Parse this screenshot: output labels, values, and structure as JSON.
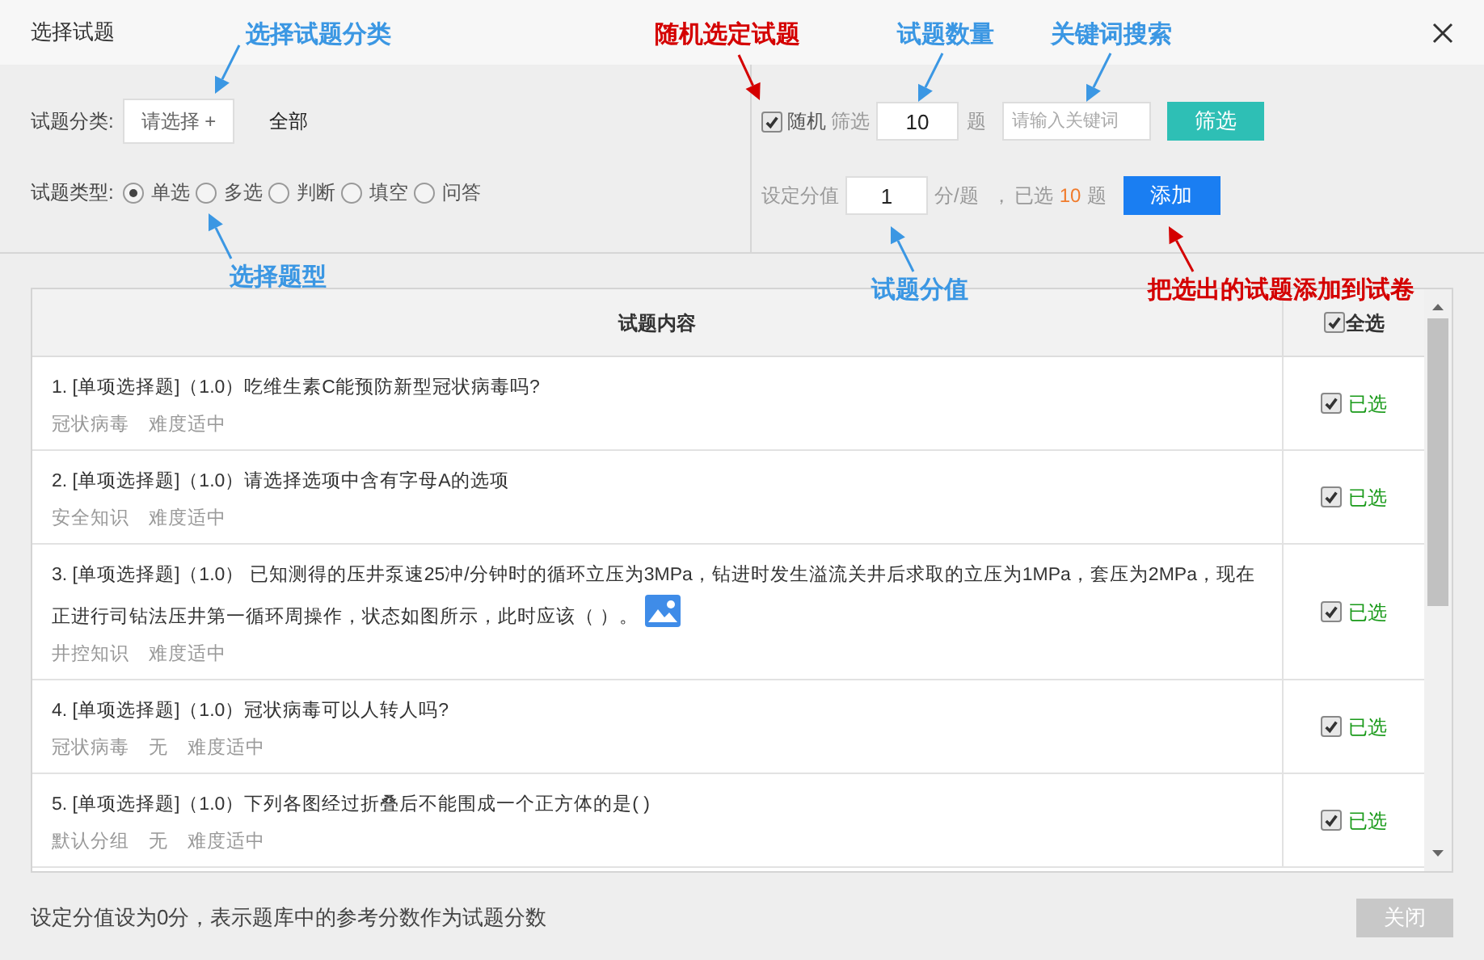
{
  "window": {
    "title": "选择试题"
  },
  "category": {
    "label": "试题分类:",
    "button": "请选择 +",
    "value": "全部"
  },
  "type_filter": {
    "label": "试题类型:",
    "options": [
      {
        "label": "单选",
        "selected": true
      },
      {
        "label": "多选",
        "selected": false
      },
      {
        "label": "判断",
        "selected": false
      },
      {
        "label": "填空",
        "selected": false
      },
      {
        "label": "问答",
        "selected": false
      }
    ]
  },
  "random": {
    "label": "随机",
    "checked": true,
    "prefix": "筛选",
    "count": "10",
    "unit": "题"
  },
  "keyword": {
    "placeholder": "请输入关键词"
  },
  "filter_button": "筛选",
  "score": {
    "label": "设定分值",
    "value": "1",
    "unit": "分/题",
    "separator": "，",
    "selected_prefix": "已选",
    "selected_count": "10",
    "selected_unit": "题"
  },
  "add_button": "添加",
  "table": {
    "columns": [
      "试题内容",
      "全选"
    ],
    "select_all_checked": true,
    "rows": [
      {
        "title": "1. [单项选择题]（1.0）吃维生素C能预防新型冠状病毒吗?",
        "tags": [
          "冠状病毒",
          "难度适中"
        ],
        "has_image": false,
        "checked": true,
        "status": "已选"
      },
      {
        "title": "2. [单项选择题]（1.0）请选择选项中含有字母A的选项",
        "tags": [
          "安全知识",
          "难度适中"
        ],
        "has_image": false,
        "checked": true,
        "status": "已选"
      },
      {
        "title": "3. [单项选择题]（1.0） 已知测得的压井泵速25冲/分钟时的循环立压为3MPa，钻进时发生溢流关井后求取的立压为1MPa，套压为2MPa，现在正进行司钻法压井第一循环周操作，状态如图所示，此时应该（ ）。",
        "tags": [
          "井控知识",
          "难度适中"
        ],
        "has_image": true,
        "checked": true,
        "status": "已选"
      },
      {
        "title": "4. [单项选择题]（1.0）冠状病毒可以人转人吗?",
        "tags": [
          "冠状病毒",
          "无",
          "难度适中"
        ],
        "has_image": false,
        "checked": true,
        "status": "已选"
      },
      {
        "title": "5. [单项选择题]（1.0）下列各图经过折叠后不能围成一个正方体的是(    )",
        "tags": [
          "默认分组",
          "无",
          "难度适中"
        ],
        "has_image": false,
        "checked": true,
        "status": "已选"
      }
    ]
  },
  "footer": {
    "note": "设定分值设为0分，表示题库中的参考分数作为试题分数",
    "close_button": "关闭"
  },
  "annotations": [
    {
      "text": "选择试题分类",
      "color": "#3b97e3"
    },
    {
      "text": "随机选定试题",
      "color": "#d40000"
    },
    {
      "text": "试题数量",
      "color": "#3b97e3"
    },
    {
      "text": "关键词搜索",
      "color": "#3b97e3"
    },
    {
      "text": "选择题型",
      "color": "#3b97e3"
    },
    {
      "text": "试题分值",
      "color": "#3b97e3"
    },
    {
      "text": "把选出的试题添加到试卷",
      "color": "#d40000"
    }
  ]
}
